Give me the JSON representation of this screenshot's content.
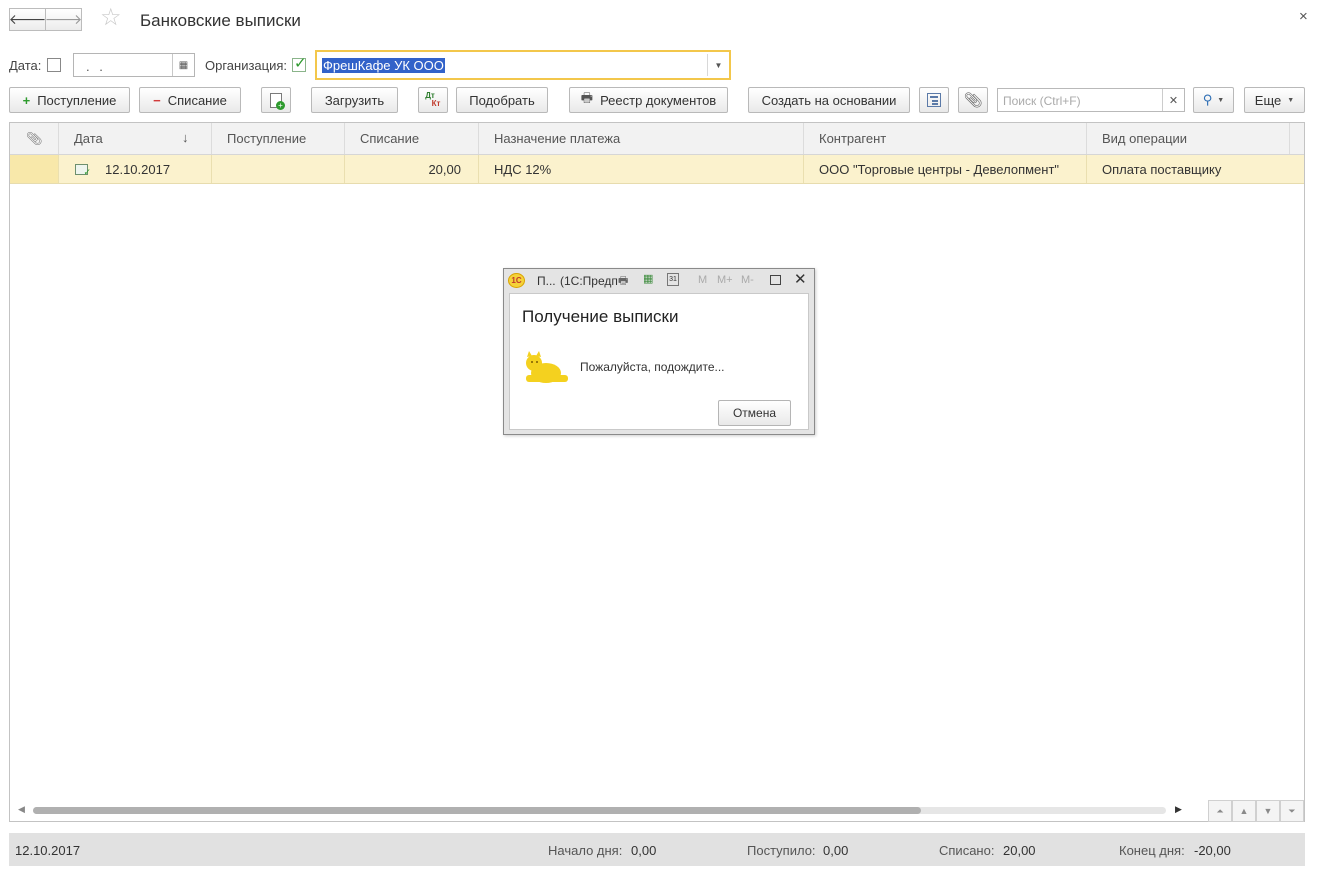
{
  "window": {
    "title": "Банковские выписки",
    "close_glyph": "×",
    "back_glyph": "🡐",
    "forward_glyph": "🡒"
  },
  "filters": {
    "date_label": "Дата:",
    "date_value": ". .",
    "org_label": "Организация:",
    "org_value": "ФрешКафе УК ООО"
  },
  "toolbar": {
    "receipt_label": "Поступление",
    "writeoff_label": "Списание",
    "load_label": "Загрузить",
    "select_label": "Подобрать",
    "registry_label": "Реестр документов",
    "create_based_label": "Создать на основании",
    "search_placeholder": "Поиск (Ctrl+F)",
    "more_label": "Еще",
    "dtkt_top": "Дт",
    "dtkt_bottom": "Кт"
  },
  "table": {
    "columns": {
      "date": "Дата",
      "receipt": "Поступление",
      "writeoff": "Списание",
      "purpose": "Назначение платежа",
      "counterparty": "Контрагент",
      "operation": "Вид операции"
    },
    "sort_glyph": "↓",
    "rows": [
      {
        "date": "12.10.2017",
        "receipt": "",
        "writeoff": "20,00",
        "purpose": "НДС 12%",
        "counterparty": "ООО \"Торговые центры - Девелопмент\"",
        "operation": "Оплата поставщику"
      }
    ]
  },
  "status": {
    "date": "12.10.2017",
    "start_label": "Начало дня:",
    "start_value": "0,00",
    "in_label": "Поступило:",
    "in_value": "0,00",
    "out_label": "Списано:",
    "out_value": "20,00",
    "end_label": "Конец дня:",
    "end_value": "-20,00"
  },
  "dialog": {
    "logo": "1С",
    "tab_short": "П...",
    "app_name": "(1С:Предп...",
    "heading": "Получение выписки",
    "message": "Пожалуйста, подождите...",
    "cancel_label": "Отмена",
    "m_label": "M",
    "mplus_label": "M+",
    "mminus_label": "M-",
    "calendar_day": "31"
  },
  "colors": {
    "selected_row": "#fbf2cd",
    "org_field_border": "#f3c74b",
    "selection_bg": "#3262c9"
  }
}
